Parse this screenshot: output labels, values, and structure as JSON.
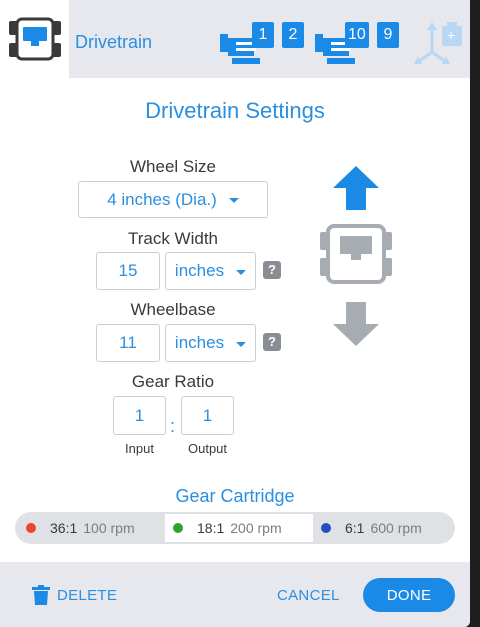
{
  "header": {
    "title": "Drivetrain",
    "ports_left": [
      "1",
      "2"
    ],
    "ports_right": [
      "10",
      "9"
    ],
    "add_glyph": "+"
  },
  "page_title": "Drivetrain Settings",
  "wheel_size": {
    "label": "Wheel Size",
    "value": "4 inches (Dia.)"
  },
  "track_width": {
    "label": "Track Width",
    "value": "15",
    "unit": "inches",
    "help": "?"
  },
  "wheelbase": {
    "label": "Wheelbase",
    "value": "11",
    "unit": "inches",
    "help": "?"
  },
  "gear_ratio": {
    "label": "Gear Ratio",
    "input_value": "1",
    "output_value": "1",
    "separator": ":",
    "input_label": "Input",
    "output_label": "Output"
  },
  "gear_cartridge": {
    "title": "Gear Cartridge",
    "options": [
      {
        "ratio": "36:1",
        "rpm": "100 rpm",
        "color": "#e8452c",
        "selected": false
      },
      {
        "ratio": "18:1",
        "rpm": "200 rpm",
        "color": "#2aa52a",
        "selected": true
      },
      {
        "ratio": "6:1",
        "rpm": "600 rpm",
        "color": "#1f4fc4",
        "selected": false
      }
    ]
  },
  "footer": {
    "delete_label": "DELETE",
    "cancel_label": "CANCEL",
    "done_label": "DONE"
  },
  "colors": {
    "accent": "#1a8ae6",
    "text_accent": "#2b8fe0",
    "header_bg": "#e6e8ee",
    "icon_gray": "#8a8d93"
  }
}
